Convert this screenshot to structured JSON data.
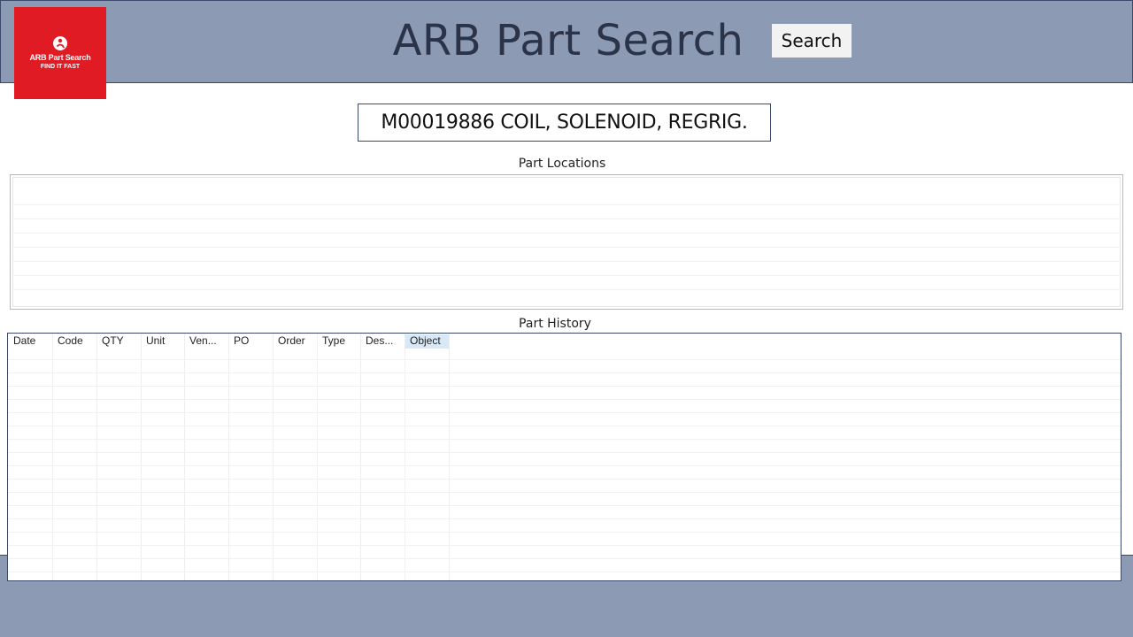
{
  "logo": {
    "icon": "pin-person-icon",
    "title": "ARB Part Search",
    "tagline": "FIND IT FAST",
    "color": "#e01b23"
  },
  "header": {
    "title": "ARB Part Search",
    "search_label": "Search",
    "band_color": "#8c9ab3"
  },
  "part_field": {
    "value": "M00019886 COIL, SOLENOID, REGRIG."
  },
  "locations": {
    "label": "Part Locations"
  },
  "history": {
    "label": "Part History",
    "columns": [
      "Date",
      "Code",
      "QTY",
      "Unit",
      "Ven...",
      "PO",
      "Order",
      "Type",
      "Des...",
      "Object"
    ],
    "selected_column": "Object",
    "selected_color": "#d9e8f7"
  }
}
